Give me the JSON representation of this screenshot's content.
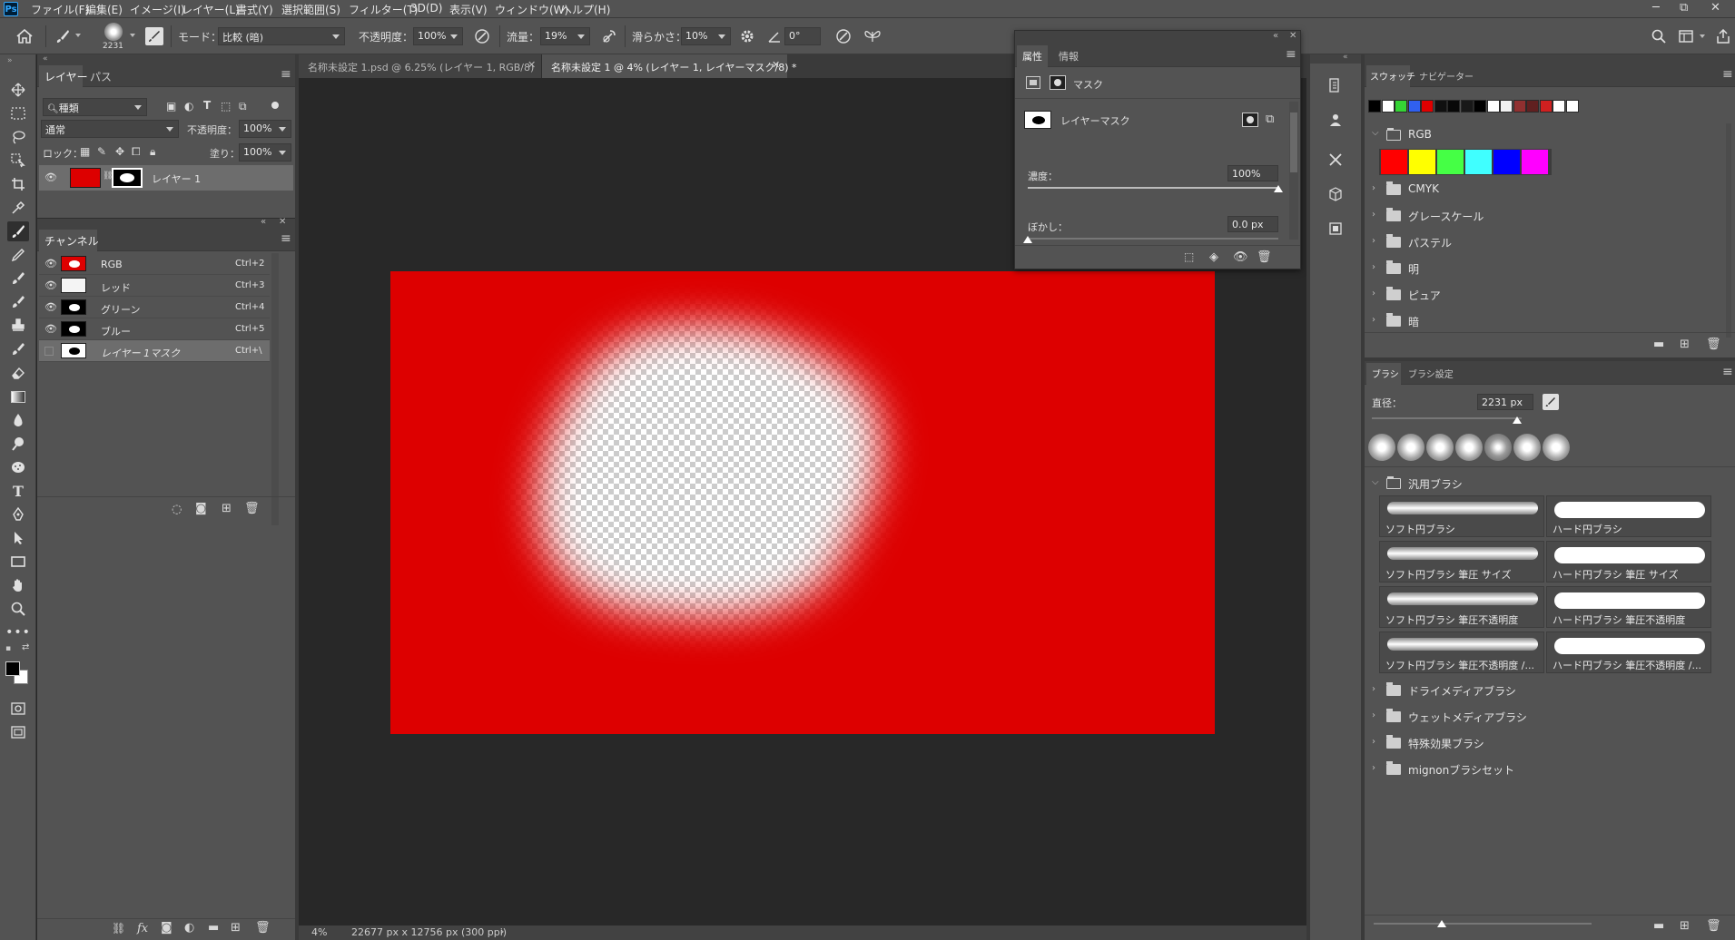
{
  "menubar": {
    "app_badge": "Ps",
    "items": [
      "ファイル(F)",
      "編集(E)",
      "イメージ(I)",
      "レイヤー(L)",
      "書式(Y)",
      "選択範囲(S)",
      "フィルター(T)",
      "3D(D)",
      "表示(V)",
      "ウィンドウ(W)",
      "ヘルプ(H)"
    ],
    "win_min": "─",
    "win_restore": "⧉",
    "win_close": "✕"
  },
  "options": {
    "brush_size": "2231",
    "mode_label": "モード：",
    "mode_value": "比較 (暗)",
    "opacity_label": "不透明度：",
    "opacity_value": "100%",
    "flow_label": "流量：",
    "flow_value": "19%",
    "smoothing_label": "滑らかさ：",
    "smoothing_value": "10%",
    "angle_value": "0°"
  },
  "layers_panel": {
    "tab_layers": "レイヤー",
    "tab_paths": "パス",
    "filter_kind": "種類",
    "blend_mode": "通常",
    "opacity_label": "不透明度：",
    "opacity_value": "100%",
    "lock_label": "ロック：",
    "fill_label": "塗り：",
    "fill_value": "100%",
    "layer_name": "レイヤー 1"
  },
  "channels_panel": {
    "title": "チャンネル",
    "rows": [
      {
        "name": "RGB",
        "shortcut": "Ctrl+2"
      },
      {
        "name": "レッド",
        "shortcut": "Ctrl+3"
      },
      {
        "name": "グリーン",
        "shortcut": "Ctrl+4"
      },
      {
        "name": "ブルー",
        "shortcut": "Ctrl+5"
      },
      {
        "name": "レイヤー 1マスク",
        "shortcut": "Ctrl+\\"
      }
    ]
  },
  "doc_tabs": [
    {
      "label": "名称未設定 1.psd @ 6.25% (レイヤー 1, RGB/8)"
    },
    {
      "label": "名称未設定 1 @ 4% (レイヤー 1, レイヤーマスク/8) *"
    }
  ],
  "properties_panel": {
    "tab_properties": "属性",
    "tab_info": "情報",
    "mask_label": "マスク",
    "layer_mask_label": "レイヤーマスク",
    "density_label": "濃度：",
    "density_value": "100%",
    "density_level": 1.0,
    "feather_label": "ぼかし：",
    "feather_value": "0.0 px",
    "feather_level": 0.0
  },
  "status": {
    "zoom": "4%",
    "doc_size": "22677 px x 12756 px (300 ppi)"
  },
  "swatches_panel": {
    "tab_swatches": "スウォッチ",
    "tab_navigator": "ナビゲーター",
    "recent_colors": [
      "#000000",
      "#ffffff",
      "#35d435",
      "#3060f0",
      "#e00000",
      "#101010",
      "#080808",
      "#181818",
      "#000000",
      "#ffffff",
      "#f0f0f0",
      "#903030",
      "#602020",
      "#d02020",
      "#ffffff",
      "#ffffff"
    ],
    "rgb_group": "RGB",
    "rgb_colors": [
      "#ff0000",
      "#ffff00",
      "#45ff45",
      "#40ffff",
      "#0000ff",
      "#ff00ff"
    ],
    "groups": [
      "CMYK",
      "グレースケール",
      "パステル",
      "明",
      "ピュア",
      "暗"
    ]
  },
  "brush_panel": {
    "tab_brush": "ブラシ",
    "tab_brush_settings": "ブラシ設定",
    "diameter_label": "直径：",
    "diameter_value": "2231 px",
    "general_group": "汎用ブラシ",
    "brushes": [
      "ソフト円ブラシ",
      "ハード円ブラシ",
      "ソフト円ブラシ 筆圧 サイズ",
      "ハード円ブラシ 筆圧 サイズ",
      "ソフト円ブラシ 筆圧不透明度",
      "ハード円ブラシ 筆圧不透明度",
      "ソフト円ブラシ 筆圧不透明度 /...",
      "ハード円ブラシ 筆圧不透明度 /..."
    ],
    "other_groups": [
      "ドライメディアブラシ",
      "ウェットメディアブラシ",
      "特殊効果ブラシ",
      "mignonブラシセット"
    ]
  },
  "colors": {
    "canvas_red": "#dd0000",
    "panel_bg": "#535353",
    "app_bg": "#282828"
  }
}
